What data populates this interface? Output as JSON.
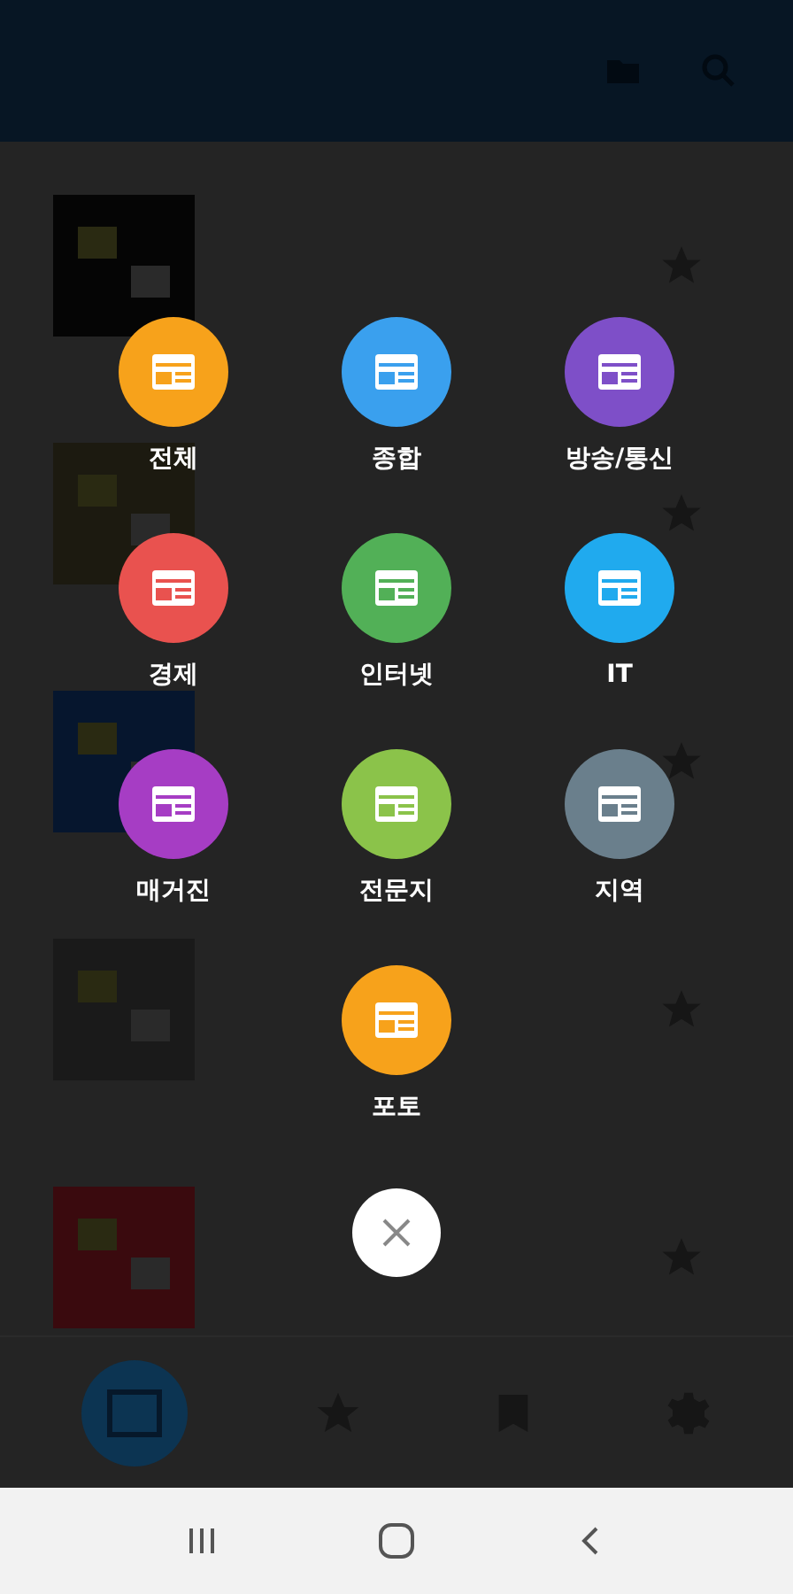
{
  "list": {
    "rows": [
      {
        "color": "#050505"
      },
      {
        "color": "#1c1a10"
      },
      {
        "color": "#06162e"
      },
      {
        "color": "#1a1a1a"
      },
      {
        "color": "#3a0a0e"
      }
    ]
  },
  "category_menu": {
    "rows": [
      [
        {
          "label": "전체",
          "color": "#f7a21b"
        },
        {
          "label": "종합",
          "color": "#3aa0ee"
        },
        {
          "label": "방송/통신",
          "color": "#7e4fc8"
        }
      ],
      [
        {
          "label": "경제",
          "color": "#e9524f"
        },
        {
          "label": "인터넷",
          "color": "#52b057"
        },
        {
          "label": "IT",
          "color": "#20aaee"
        }
      ],
      [
        {
          "label": "매거진",
          "color": "#a63dc4"
        },
        {
          "label": "전문지",
          "color": "#8bc34a"
        },
        {
          "label": "지역",
          "color": "#6a7f8c"
        }
      ],
      [
        "",
        {
          "label": "포토",
          "color": "#f7a21b"
        }
      ]
    ]
  },
  "bottom_nav": {
    "items": [
      {
        "kind": "news",
        "selected": true
      },
      {
        "kind": "star",
        "selected": false
      },
      {
        "kind": "list",
        "selected": false
      },
      {
        "kind": "gear",
        "selected": false
      }
    ]
  }
}
